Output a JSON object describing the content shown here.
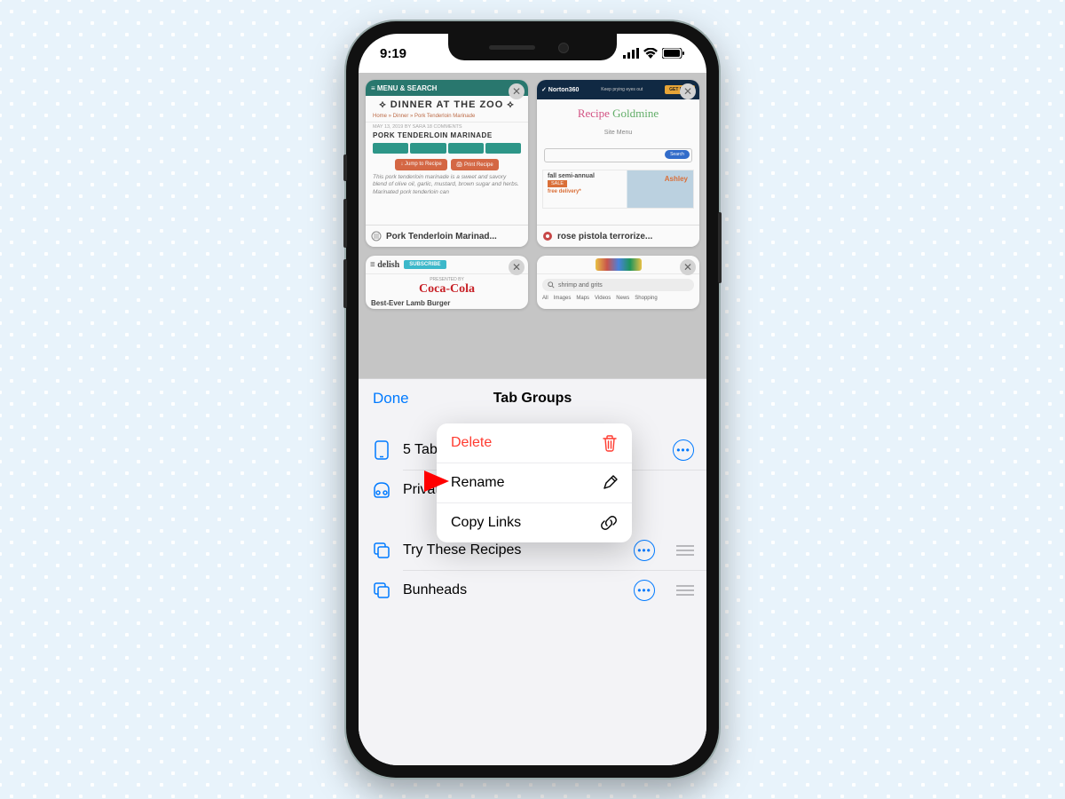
{
  "status": {
    "time": "9:19"
  },
  "tabs": [
    {
      "title": "Pork Tenderloin Marinad...",
      "menu_bar": "≡ MENU & SEARCH",
      "logo": "DINNER AT THE ZOO",
      "breadcrumb": "Home » Dinner » Pork Tenderloin Marinade",
      "meta": "MAY 13, 2019 BY SARA   18 COMMENTS",
      "recipe_title": "PORK TENDERLOIN MARINADE",
      "jump": "↓ Jump to Recipe",
      "print": "🖨 Print Recipe",
      "desc": "This pork tenderloin marinade is a sweet and savory blend of olive oil, garlic, mustard, brown sugar and herbs. Marinated pork tenderloin can"
    },
    {
      "title": "rose pistola terrorize...",
      "norton": "✓ Norton360",
      "ad_text": "Keep prying eyes out",
      "ad_btn": "GET NOW",
      "site": "Recipe Goldmine",
      "menu": "Site Menu",
      "search_btn": "Search",
      "ash_head": "fall semi-annual",
      "ash_sale": "SALE",
      "ash_free": "free delivery*",
      "ash_logo": "Ashley"
    },
    {
      "brand": "≡ delish",
      "subscribe": "SUBSCRIBE",
      "presented": "PRESENTED BY",
      "coke": "Coca-Cola",
      "article": "Best-Ever Lamb Burger"
    },
    {
      "query": "shrimp and grits",
      "gtabs": [
        "All",
        "Images",
        "Maps",
        "Videos",
        "News",
        "Shopping"
      ]
    }
  ],
  "sheet": {
    "done": "Done",
    "title": "Tab Groups",
    "row_tabs": "5 Tabs",
    "row_private": "Private",
    "groups": [
      {
        "label": "Try These Recipes"
      },
      {
        "label": "Bunheads"
      }
    ]
  },
  "popover": {
    "delete": "Delete",
    "rename": "Rename",
    "copy": "Copy Links"
  }
}
